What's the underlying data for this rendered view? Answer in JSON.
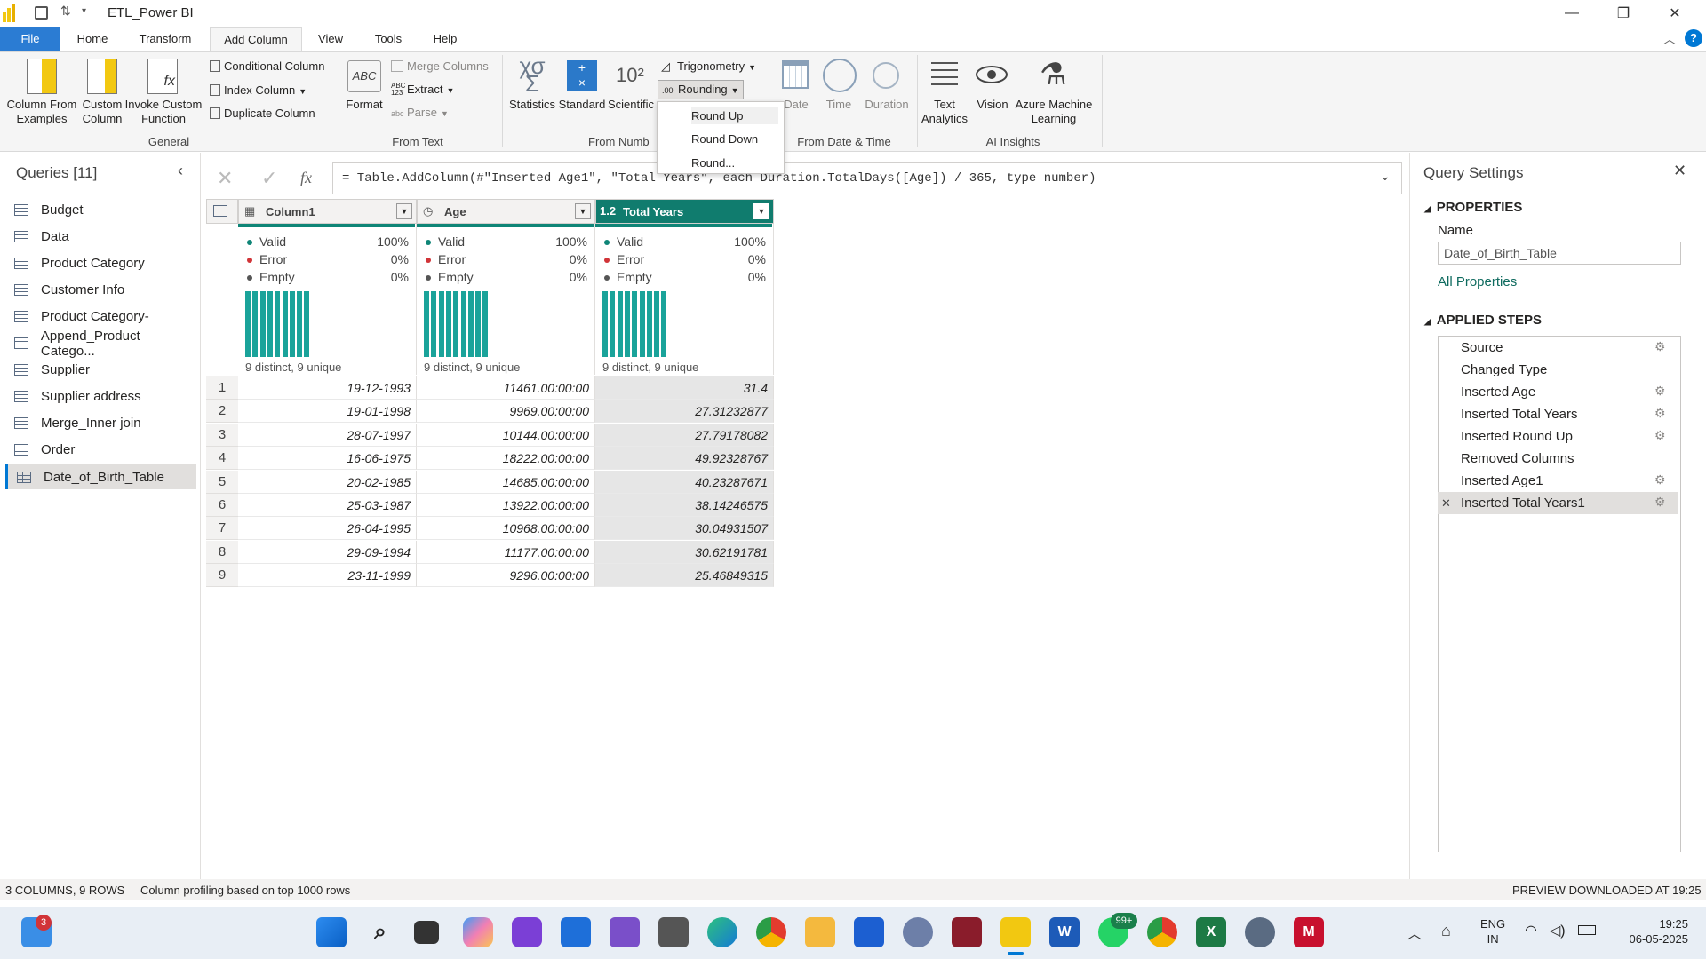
{
  "window": {
    "title": "ETL_Power BI"
  },
  "tabs": [
    "File",
    "Home",
    "Transform",
    "Add Column",
    "View",
    "Tools",
    "Help"
  ],
  "ribbon": {
    "column_from_examples": "Column From Examples",
    "custom_column": "Custom Column",
    "invoke_custom_function": "Invoke Custom Function",
    "conditional_column": "Conditional Column",
    "index_column": "Index Column",
    "duplicate_column": "Duplicate Column",
    "group_general": "General",
    "format": "Format",
    "merge_columns": "Merge Columns",
    "extract": "Extract",
    "parse": "Parse",
    "group_from_text": "From Text",
    "statistics": "Statistics",
    "standard": "Standard",
    "scientific": "Scientific",
    "scientific_glyph": "10²",
    "trigonometry": "Trigonometry",
    "rounding": "Rounding",
    "group_from_number": "From Numb",
    "date": "Date",
    "time": "Time",
    "duration": "Duration",
    "group_from_date_time": "From Date & Time",
    "text_analytics": "Text Analytics",
    "vision": "Vision",
    "azure_ml": "Azure Machine Learning",
    "group_ai_insights": "AI Insights",
    "abc_glyph": "ABC",
    "abc123_glyph": "ABC 123",
    "abc_small": "abc"
  },
  "rounding_menu": [
    "Round Up",
    "Round Down",
    "Round..."
  ],
  "queries": {
    "header": "Queries [11]",
    "items": [
      "Budget",
      "Data",
      "Product Category",
      "Customer Info",
      "Product Category-",
      "Append_Product Catego...",
      "Supplier",
      "Supplier address",
      "Merge_Inner join",
      "Order",
      "Date_of_Birth_Table"
    ],
    "selected": "Date_of_Birth_Table"
  },
  "formula": {
    "fx": "fx",
    "text": "= Table.AddColumn(#\"Inserted Age1\", \"Total Years\", each Duration.TotalDays([Age]) / 365, type number)"
  },
  "columns": [
    {
      "name": "Column1",
      "type_glyph": "▦",
      "valid": "100%",
      "error": "0%",
      "empty": "0%",
      "distinct": "9 distinct, 9 unique"
    },
    {
      "name": "Age",
      "type_glyph": "◷",
      "valid": "100%",
      "error": "0%",
      "empty": "0%",
      "distinct": "9 distinct, 9 unique"
    },
    {
      "name": "Total Years",
      "type_glyph": "1.2",
      "valid": "100%",
      "error": "0%",
      "empty": "0%",
      "distinct": "9 distinct, 9 unique"
    }
  ],
  "profile_labels": {
    "valid": "Valid",
    "error": "Error",
    "empty": "Empty"
  },
  "rows": [
    {
      "n": "1",
      "c1": "19-12-1993",
      "age": "11461.00:00:00",
      "years": "31.4"
    },
    {
      "n": "2",
      "c1": "19-01-1998",
      "age": "9969.00:00:00",
      "years": "27.31232877"
    },
    {
      "n": "3",
      "c1": "28-07-1997",
      "age": "10144.00:00:00",
      "years": "27.79178082"
    },
    {
      "n": "4",
      "c1": "16-06-1975",
      "age": "18222.00:00:00",
      "years": "49.92328767"
    },
    {
      "n": "5",
      "c1": "20-02-1985",
      "age": "14685.00:00:00",
      "years": "40.23287671"
    },
    {
      "n": "6",
      "c1": "25-03-1987",
      "age": "13922.00:00:00",
      "years": "38.14246575"
    },
    {
      "n": "7",
      "c1": "26-04-1995",
      "age": "10968.00:00:00",
      "years": "30.04931507"
    },
    {
      "n": "8",
      "c1": "29-09-1994",
      "age": "11177.00:00:00",
      "years": "30.62191781"
    },
    {
      "n": "9",
      "c1": "23-11-1999",
      "age": "9296.00:00:00",
      "years": "25.46849315"
    }
  ],
  "settings": {
    "title": "Query Settings",
    "properties": "PROPERTIES",
    "name_label": "Name",
    "name_value": "Date_of_Birth_Table",
    "all_properties": "All Properties",
    "applied_steps": "APPLIED STEPS",
    "steps": [
      "Source",
      "Changed Type",
      "Inserted Age",
      "Inserted Total Years",
      "Inserted Round Up",
      "Removed Columns",
      "Inserted Age1",
      "Inserted Total Years1"
    ]
  },
  "status": {
    "left": "3 COLUMNS, 9 ROWS",
    "profiling": "Column profiling based on top 1000 rows",
    "right": "PREVIEW DOWNLOADED AT 19:25"
  },
  "taskbar": {
    "lang1": "ENG",
    "lang2": "IN",
    "time": "19:25",
    "date": "06-05-2025",
    "badge_left": "3",
    "badge_whatsapp": "99+"
  },
  "colors": {
    "accent": "#0078d4",
    "teal": "#0f8577",
    "total_header": "#107c6e"
  }
}
